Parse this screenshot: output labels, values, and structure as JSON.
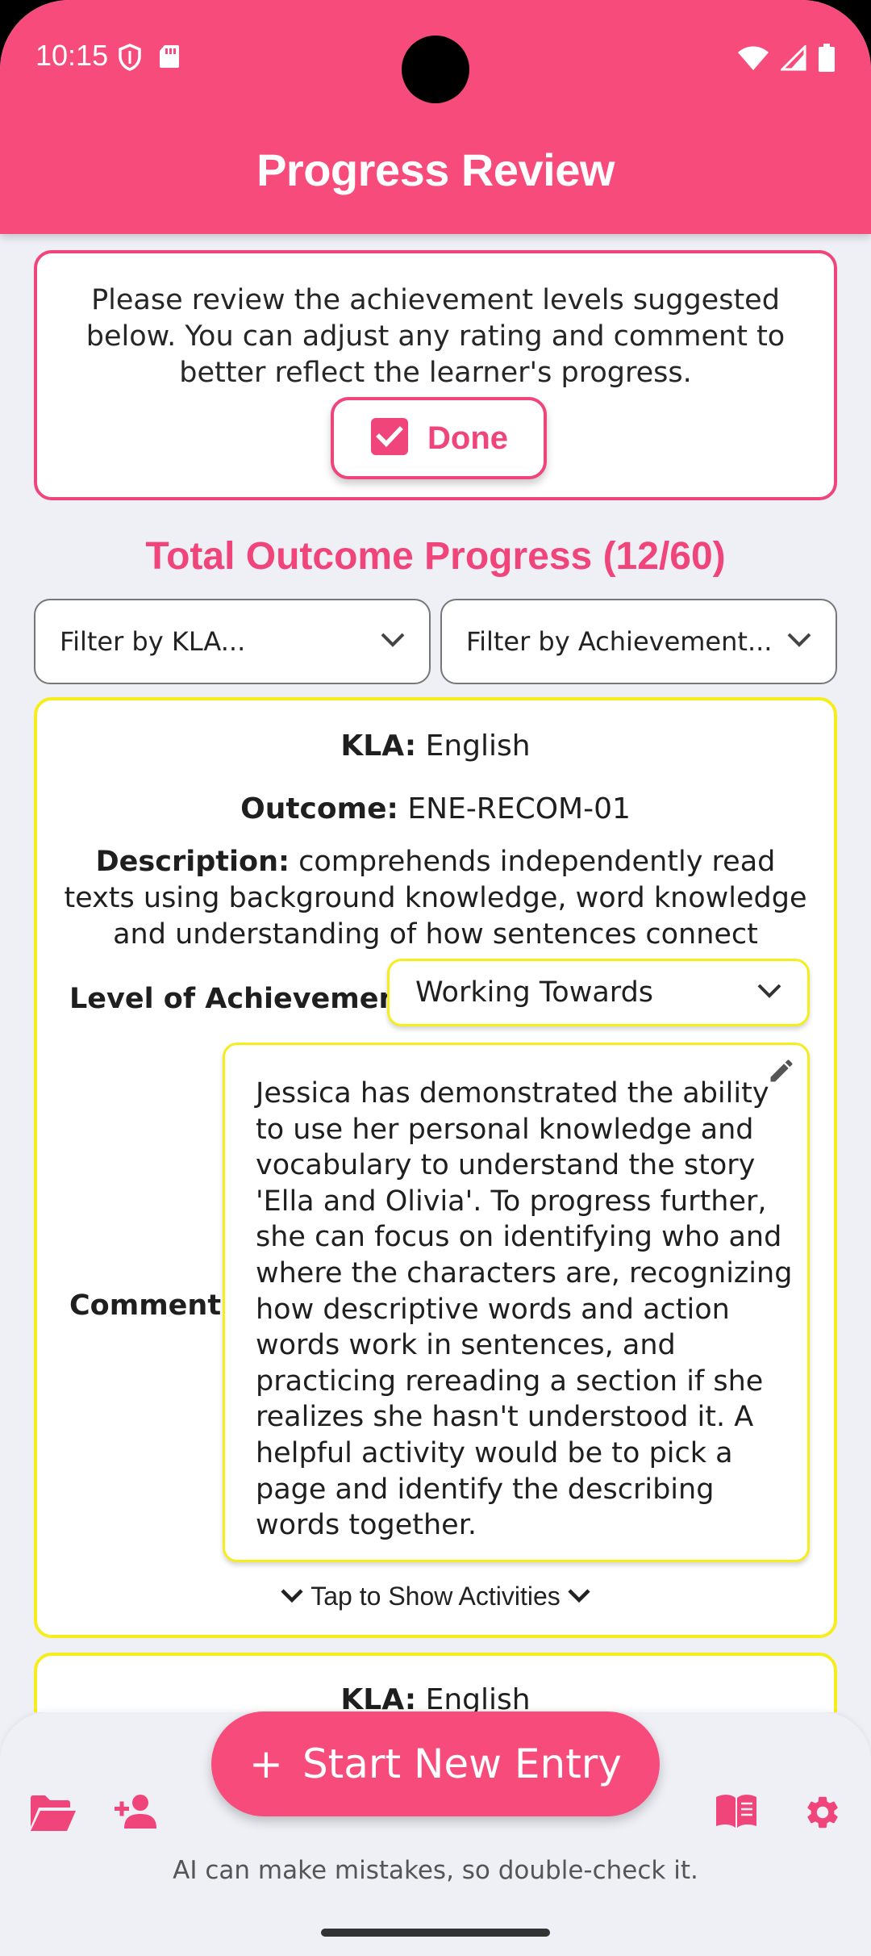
{
  "status_bar": {
    "time": "10:15"
  },
  "header": {
    "title": "Progress Review"
  },
  "intro": {
    "text": "Please review the achievement levels suggested below. You can adjust any rating and comment to better reflect the learner's progress.",
    "done_label": "Done"
  },
  "progress": {
    "heading": "Total Outcome Progress (12/60)"
  },
  "filters": {
    "kla_label": "Filter by KLA...",
    "achievement_label": "Filter by Achievement..."
  },
  "outcome_cards": [
    {
      "kla_label": "KLA:",
      "kla_value": "English",
      "outcome_label": "Outcome:",
      "outcome_value": "ENE-RECOM-01",
      "description_label": "Description:",
      "description_value": "comprehends independently read texts using background knowledge, word knowledge and understanding of how sentences connect",
      "level_label": "Level of Achievement:",
      "level_value": "Working Towards",
      "comment_label": "Comment:",
      "comment_value": "Jessica has demonstrated the ability to use her personal knowledge and vocabulary to understand the story 'Ella and Olivia'. To progress further, she can focus on identifying who and where the characters are, recognizing how descriptive words and action words work in sentences, and practicing rereading a section if she realizes she hasn't understood it. A helpful activity would be to pick a page and identify the describing words together.",
      "activities_toggle": "Tap to Show Activities"
    },
    {
      "kla_label": "KLA:",
      "kla_value": "English"
    }
  ],
  "bottom_bar": {
    "fab_label": "Start New Entry",
    "disclaimer": "AI can make mistakes, so double-check it."
  },
  "colors": {
    "brand": "#f74c7b",
    "accent_text": "#f0457a",
    "card_border_yellow": "#f5ee1c",
    "background": "#eef0f6"
  },
  "icons": [
    "shield-icon",
    "sd-card-icon",
    "wifi-icon",
    "signal-icon",
    "battery-icon",
    "checkbox-icon",
    "chevron-down-icon",
    "pencil-icon",
    "folder-open-icon",
    "add-person-icon",
    "book-icon",
    "gear-icon"
  ]
}
